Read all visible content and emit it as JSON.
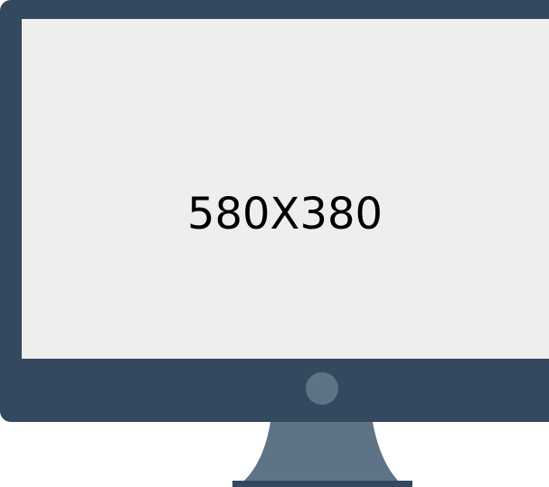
{
  "screen": {
    "label": "580X380"
  },
  "icons": {
    "power_button": "power-button-icon"
  },
  "colors": {
    "frame": "#34495e",
    "screen": "#eeeeee",
    "stand": "#5f7387",
    "base": "#34495e",
    "power_button": "#5f7387",
    "label": "#000000"
  }
}
